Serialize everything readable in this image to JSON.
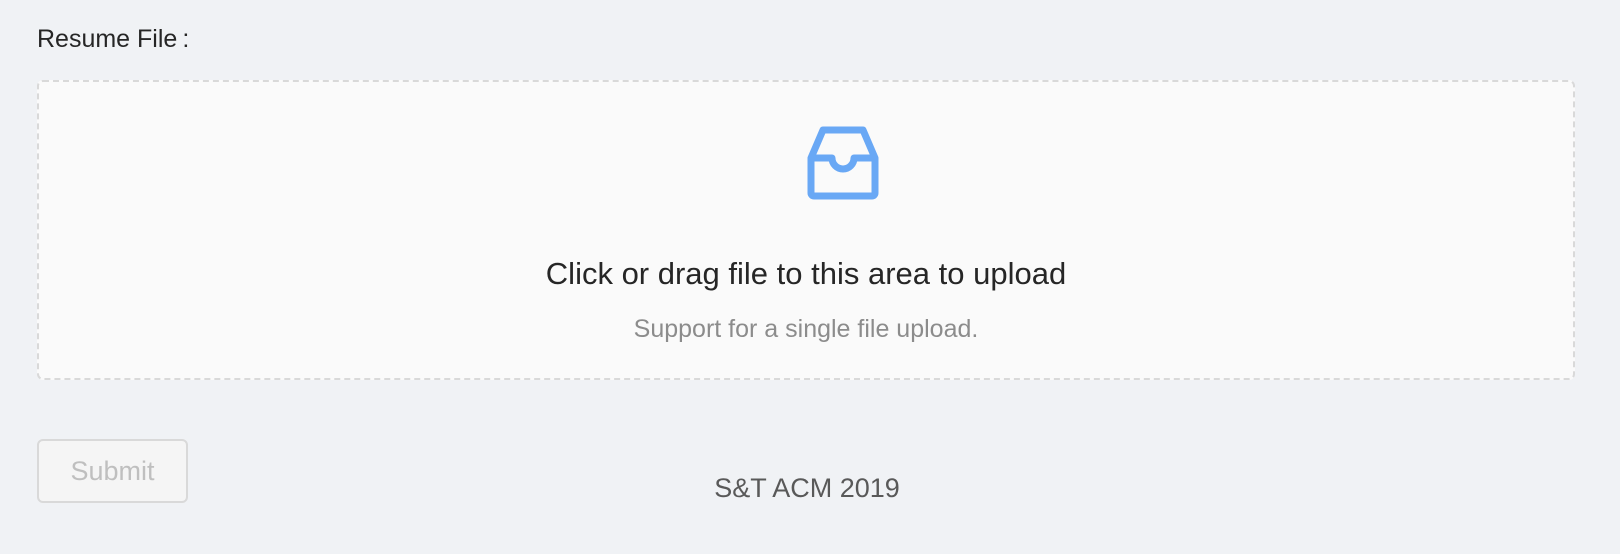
{
  "form": {
    "label": "Resume File",
    "colon": ":"
  },
  "upload": {
    "icon": "inbox-icon",
    "text": "Click or drag file to this area to upload",
    "hint": "Support for a single file upload.",
    "accent_color": "#69a8f5"
  },
  "submit": {
    "label": "Submit",
    "disabled": true
  },
  "footer": {
    "text": "S&T ACM 2019"
  }
}
